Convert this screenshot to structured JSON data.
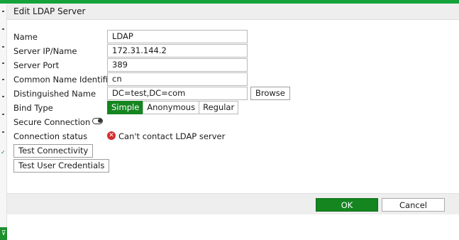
{
  "dialog": {
    "title": "Edit LDAP Server"
  },
  "form": {
    "name": {
      "label": "Name",
      "value": "LDAP"
    },
    "server_ip": {
      "label": "Server IP/Name",
      "value": "172.31.144.2"
    },
    "server_port": {
      "label": "Server Port",
      "value": "389"
    },
    "common_name": {
      "label": "Common Name Identifier",
      "value": "cn"
    },
    "dn": {
      "label": "Distinguished Name",
      "value": "DC=test,DC=com",
      "browse_label": "Browse"
    },
    "bind_type": {
      "label": "Bind Type",
      "options": [
        "Simple",
        "Anonymous",
        "Regular"
      ],
      "selected": "Simple"
    },
    "secure_connection": {
      "label": "Secure Connection",
      "enabled": false
    },
    "connection_status": {
      "label": "Connection status",
      "icon": "error-x-icon",
      "value": "Can't contact LDAP server"
    },
    "test_connectivity_label": "Test Connectivity",
    "test_user_credentials_label": "Test User Credentials"
  },
  "footer": {
    "ok_label": "OK",
    "cancel_label": "Cancel"
  },
  "colors": {
    "accent": "#14851f",
    "top_bar": "#14a23a",
    "error": "#d32f2f"
  }
}
